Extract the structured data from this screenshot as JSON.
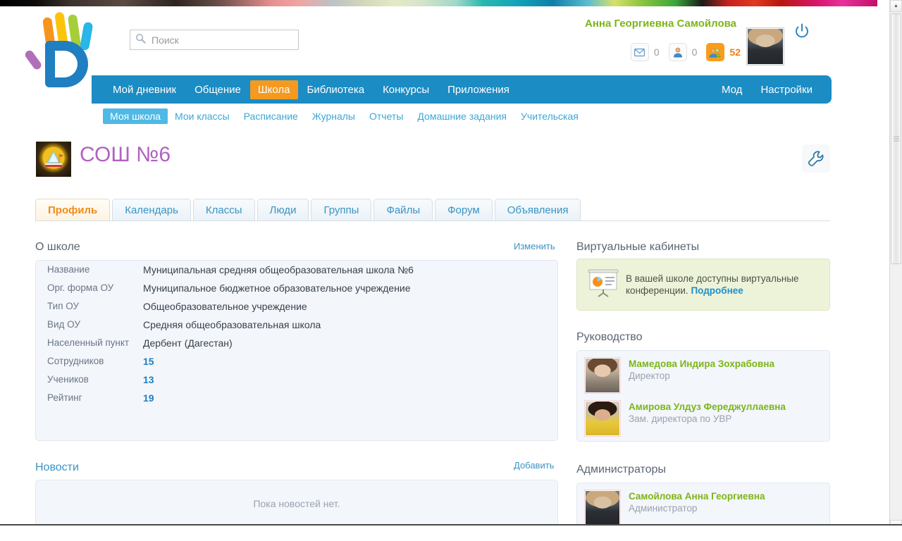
{
  "browser": {
    "scrollbar": {
      "up_label": "▲",
      "down_label": "▼"
    }
  },
  "header": {
    "logo_name": "dnevnik-hand-logo",
    "search": {
      "placeholder": "Поиск",
      "value": ""
    },
    "user_name": "Анна Георгиевна Самойлова",
    "avatar_name": "user-avatar",
    "power_label": "power-icon",
    "counters": [
      {
        "icon": "envelope-icon",
        "glyph": "✉",
        "count": "0",
        "active": false
      },
      {
        "icon": "person-icon",
        "glyph": "👤",
        "count": "0",
        "active": false
      },
      {
        "icon": "group-icon",
        "glyph": "👥",
        "count": "52",
        "active": true
      }
    ]
  },
  "mainnav": {
    "left": [
      {
        "label": "Мой дневник",
        "active": false
      },
      {
        "label": "Общение",
        "active": false
      },
      {
        "label": "Школа",
        "active": true
      },
      {
        "label": "Библиотека",
        "active": false
      },
      {
        "label": "Конкурсы",
        "active": false
      },
      {
        "label": "Приложения",
        "active": false
      }
    ],
    "right": [
      {
        "label": "Мод",
        "active": false
      },
      {
        "label": "Настройки",
        "active": false
      }
    ]
  },
  "subnav": [
    {
      "label": "Моя школа",
      "active": true
    },
    {
      "label": "Мои классы",
      "active": false
    },
    {
      "label": "Расписание",
      "active": false
    },
    {
      "label": "Журналы",
      "active": false
    },
    {
      "label": "Отчеты",
      "active": false
    },
    {
      "label": "Домашние задания",
      "active": false
    },
    {
      "label": "Учительская",
      "active": false
    }
  ],
  "school": {
    "title": "СОШ №6",
    "icon_name": "school-emblem-icon",
    "settings_icon": "wrench-icon"
  },
  "tabs": [
    {
      "label": "Профиль",
      "active": true
    },
    {
      "label": "Календарь",
      "active": false
    },
    {
      "label": "Классы",
      "active": false
    },
    {
      "label": "Люди",
      "active": false
    },
    {
      "label": "Группы",
      "active": false
    },
    {
      "label": "Файлы",
      "active": false
    },
    {
      "label": "Форум",
      "active": false
    },
    {
      "label": "Объявления",
      "active": false
    }
  ],
  "about": {
    "title": "О школе",
    "edit_link": "Изменить",
    "rows": [
      {
        "key": "Название",
        "value": "Муниципальная средняя общеобразовательная школа №6",
        "numeric": false
      },
      {
        "key": "Орг. форма ОУ",
        "value": "Муниципальное бюджетное образовательное учреждение",
        "numeric": false
      },
      {
        "key": "Тип ОУ",
        "value": "Общеобразовательное учреждение",
        "numeric": false
      },
      {
        "key": "Вид ОУ",
        "value": "Средняя общеобразовательная школа",
        "numeric": false
      },
      {
        "key": "Населенный пункт",
        "value": "Дербент (Дагестан)",
        "numeric": false
      },
      {
        "key": "Сотрудников",
        "value": "15",
        "numeric": true
      },
      {
        "key": "Учеников",
        "value": "13",
        "numeric": true
      },
      {
        "key": "Рейтинг",
        "value": "19",
        "numeric": true
      }
    ]
  },
  "news": {
    "title": "Новости",
    "add_link": "Добавить",
    "empty_text": "Пока новостей нет."
  },
  "virtual_cabinets": {
    "title": "Виртуальные кабинеты",
    "icon_name": "presentation-chart-icon",
    "text": "В вашей школе доступны виртуальные конференции. ",
    "link": "Подробнее"
  },
  "leadership": {
    "title": "Руководство",
    "people": [
      {
        "name": "Мамедова Индира Зохрабовна",
        "role": "Директор",
        "avatar": "pa-1"
      },
      {
        "name": "Амирова Улдуз Фереджуллаевна",
        "role": "Зам. директора по УВР",
        "avatar": "pa-2"
      }
    ]
  },
  "administrators": {
    "title": "Администраторы",
    "people": [
      {
        "name": "Самойлова Анна Георгиевна",
        "role": "Администратор",
        "avatar": "pa-3"
      }
    ]
  },
  "colors": {
    "nav_blue": "#1b8cc4",
    "accent_orange": "#f59a1e",
    "link_blue": "#3a93c4",
    "name_green": "#7cb518",
    "title_purple": "#b062c0",
    "panel_bg": "#f3f6fb",
    "cabinet_green": "#edf3d8"
  }
}
